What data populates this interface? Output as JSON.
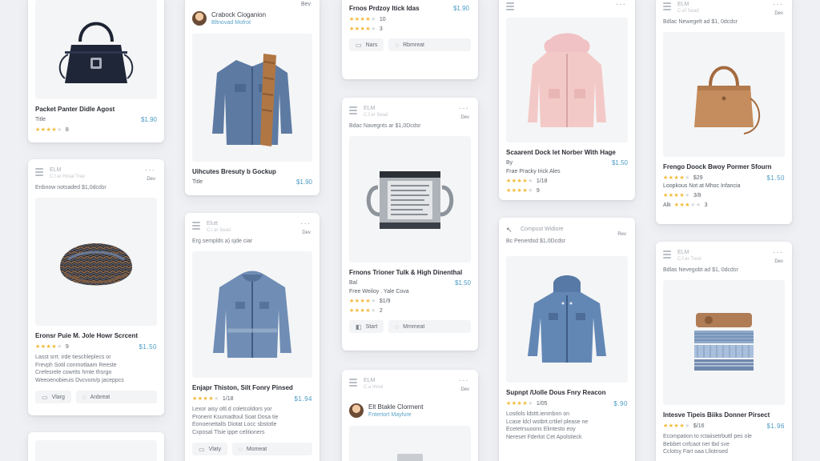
{
  "cards": {
    "c1": {
      "title": "Packet Panter Didle Agost",
      "sub": "Title",
      "price": "$1.90",
      "rating": "8"
    },
    "c2": {
      "header": {
        "brand": "ELM",
        "sub": "C.f.er Hroal Trav",
        "tag": "Dev",
        "line": "Enbnow notsaded $1,0dcdsr"
      },
      "title": "Eronsr Puie M. Jole Howr Scrcent",
      "price": "$1.50",
      "rating": "9",
      "desc": [
        "Lasst srrt. irde tieschleplecs or",
        "Frevph Sotil conmotlaam Reeste",
        "Crefesrele cowrtts hmte thsrgo",
        "Weeoenobieuis Dvcvom/p jaceppcs"
      ],
      "actions": [
        "Vlarg",
        "Anbreat"
      ]
    },
    "c3": {
      "tag": "Bev",
      "user": {
        "name": "Crabock Cioganion",
        "handle": "Bltnovad Mofrot"
      },
      "title": "Uihcutes Bresuty b Gockup",
      "sub": "Title",
      "price": "$1.90"
    },
    "c4": {
      "header": {
        "brand": "Elutt",
        "sub": "C.i ar Sead",
        "tag": "Dev",
        "line": "Erg semplds a) sjde ciar"
      },
      "title": "Enjapr Thiston, Silt Fonry Pinsed",
      "price": "$1.94",
      "rating": "1/18",
      "desc": [
        "Lexor aisy oltl.d coletcoldors yor",
        "Pronent Ksumadtoul Soat Dosa tie",
        "Eonoenettalls Diotat Locc sbstotle",
        "Cxposal Tlsie ippe celitioners"
      ],
      "actions": [
        "Vlaty",
        "Momeat"
      ]
    },
    "c5": {
      "title": "Frnos Prdzoy Itick Idas",
      "price": "$1.90",
      "rating1": "10",
      "rating2": "3",
      "actions": [
        "Nars",
        "Rbmreat"
      ]
    },
    "c6": {
      "header": {
        "brand": "ELM",
        "sub": "C.f.er Sead",
        "tag": "Dev",
        "line": "Bdac Navegnts ar $1,0Dcdsr"
      },
      "title": "Frnons Trioner Tulk & High Dinenthal",
      "sub": "Bal",
      "price": "$1.50",
      "meta": "Free Weiloy . Yale Cova",
      "rating1": "$1/9",
      "rating2": "2",
      "actions": [
        "Start",
        "Mmmeat"
      ]
    },
    "c7": {
      "header": {
        "brand": "ELM",
        "sub": "C.a Irtool",
        "tag": "Dev"
      },
      "user": {
        "name": "Elt Btakle Clorment",
        "handle": "Fntertort Mayfure"
      }
    },
    "c8": {
      "title": "Scaarent Dock let Norber With Hage",
      "sub": "By",
      "price": "$1.50",
      "meta": "Frae Pracky Irick Ales",
      "rating1": "1/18",
      "rating2": "9"
    },
    "c9": {
      "header": {
        "brand": "Compust Widiore",
        "tag": "Rev",
        "line": "Bc Penerdsd $1,0Dcdsr"
      },
      "title": "Supnpt /Uolle Dous Fnry Reacon",
      "price": "$.90",
      "rating": "1/05",
      "desc": [
        "Lostlols ldsttt.ienmbnn on",
        "Lcase ldcl wstbrt.crtliel please ne",
        "Ecetetrsuoons Elintesto eoy",
        "Nereset Fderlot Cet Apolstieck"
      ]
    },
    "c10": {
      "header": {
        "brand": "ELM",
        "sub": "C.ef Sead",
        "tag": "Dev",
        "line": "Bdlac Newegelt ad $1, 0dcdsr"
      },
      "title": "Frengo Doock Bwoy Pormer Sfourn",
      "price": "$1.50",
      "rating": "$29",
      "meta": "Loopkous Not at Mhoc Infancia",
      "rating2": "3/8",
      "rating3": "3",
      "rating3_label": "Alk"
    },
    "c11": {
      "header": {
        "brand": "ELM",
        "sub": "C.f.er Treol",
        "tag": "Dev",
        "line": "Bdlas Nevegobt ad $1, 0dcdsr"
      },
      "title": "Intesve Tipeis Biiks Donner Pirsect",
      "price": "$1.96",
      "rating": "$/16",
      "desc": [
        "Ecompation to rctaiisetrbuttl pes ole",
        "Bebbet cnfcaot net tbd sve",
        "Cclotsy Fart oaa Lllotnsed"
      ]
    }
  },
  "colors": {
    "accent": "#4c9bc4",
    "star": "#f2b937",
    "background": "#eef0f3"
  },
  "icons": [
    "grid-icon",
    "more-dots-icon",
    "star-icon",
    "bag-icon",
    "cart-icon",
    "chat-icon",
    "back-arrow-icon"
  ]
}
